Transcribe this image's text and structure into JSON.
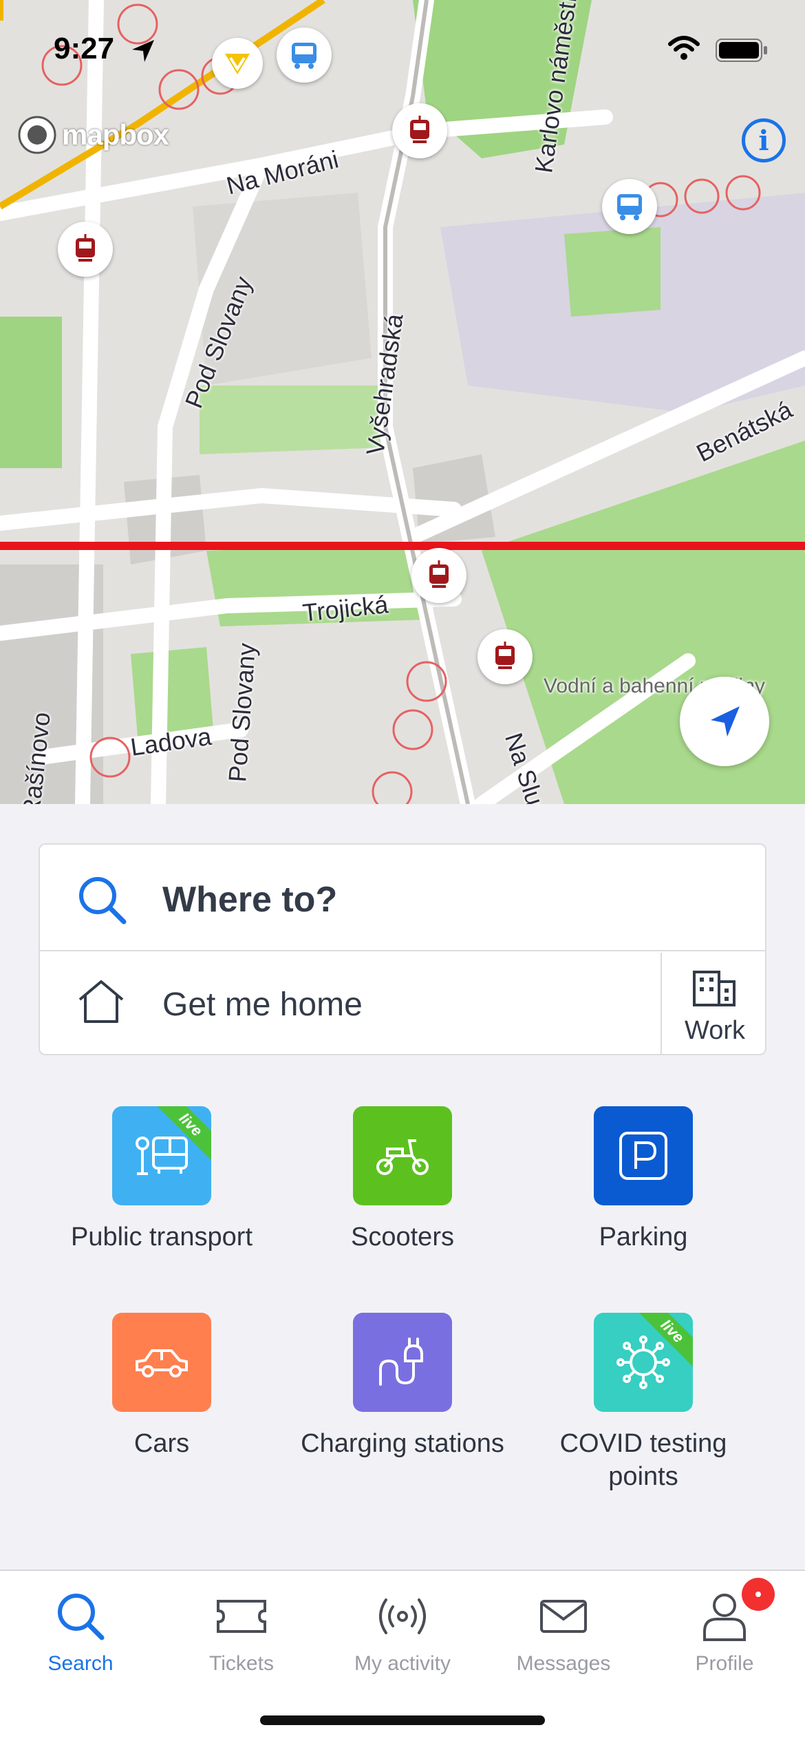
{
  "status_bar": {
    "time": "9:27"
  },
  "map": {
    "attribution": "mapbox",
    "info_label": "i",
    "streets": [
      {
        "name": "Na Moráni"
      },
      {
        "name": "Karlovo náměstí"
      },
      {
        "name": "Pod Slovany"
      },
      {
        "name": "Vyšehradská"
      },
      {
        "name": "Benátská"
      },
      {
        "name": "Trojická"
      },
      {
        "name": "Pod Slovany"
      },
      {
        "name": "Ladova"
      },
      {
        "name": "Rašínovo"
      },
      {
        "name": "Na Slupi"
      },
      {
        "name": "Vodní a bahenní rostliny"
      }
    ],
    "route_line_color": "#e8141b"
  },
  "search": {
    "placeholder": "Where to?",
    "home_label": "Get me home",
    "work_label": "Work"
  },
  "categories": [
    {
      "label": "Public transport",
      "color": "#3fb1f2",
      "icon": "bus-stop-icon",
      "live": "live"
    },
    {
      "label": "Scooters",
      "color": "#5cc11f",
      "icon": "scooter-icon"
    },
    {
      "label": "Parking",
      "color": "#0a5bd1",
      "icon": "parking-icon"
    },
    {
      "label": "Cars",
      "color": "#ff7f4f",
      "icon": "car-icon"
    },
    {
      "label": "Charging stations",
      "color": "#7a6fe0",
      "icon": "plug-icon"
    },
    {
      "label": "COVID testing points",
      "color": "#36cfc2",
      "icon": "virus-icon",
      "live": "live"
    }
  ],
  "tabbar": {
    "tabs": [
      {
        "label": "Search",
        "icon": "search-icon",
        "active": true
      },
      {
        "label": "Tickets",
        "icon": "ticket-icon"
      },
      {
        "label": "My activity",
        "icon": "broadcast-icon"
      },
      {
        "label": "Messages",
        "icon": "envelope-icon"
      },
      {
        "label": "Profile",
        "icon": "person-icon"
      }
    ]
  },
  "accent_color": "#1a73e8"
}
